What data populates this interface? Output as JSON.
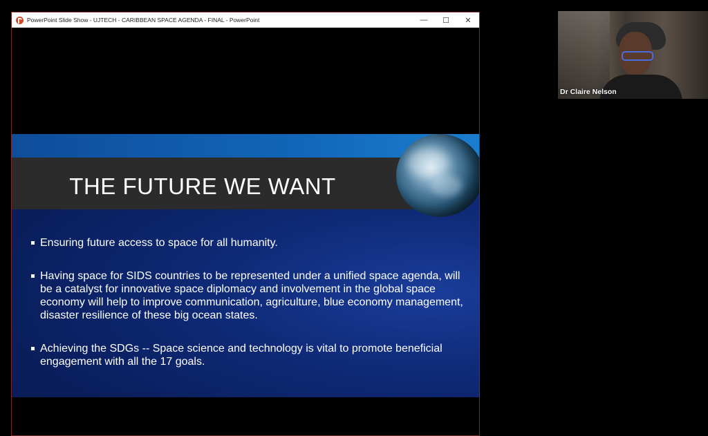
{
  "window": {
    "title": "PowerPoint Slide Show  -  UJTECH - CARIBBEAN SPACE AGENDA - FINAL - PowerPoint",
    "controls": {
      "minimize": "—",
      "maximize": "☐",
      "close": "✕"
    }
  },
  "slide": {
    "title": "THE FUTURE WE WANT",
    "bullets": [
      "Ensuring future access to space for all humanity.",
      "Having space for SIDS countries to be represented under a unified space agenda, will be a catalyst for innovative space diplomacy and involvement in the global space economy will help to improve communication, agriculture, blue economy management, disaster resilience of these big ocean states.",
      "Achieving the SDGs -- Space science and technology is vital to promote beneficial engagement with all the 17 goals."
    ]
  },
  "participant": {
    "name": "Dr Claire Nelson"
  },
  "colors": {
    "slide_background": "#0f2a78",
    "title_band": "#2b2b2b",
    "accent_close": "#d24726"
  }
}
